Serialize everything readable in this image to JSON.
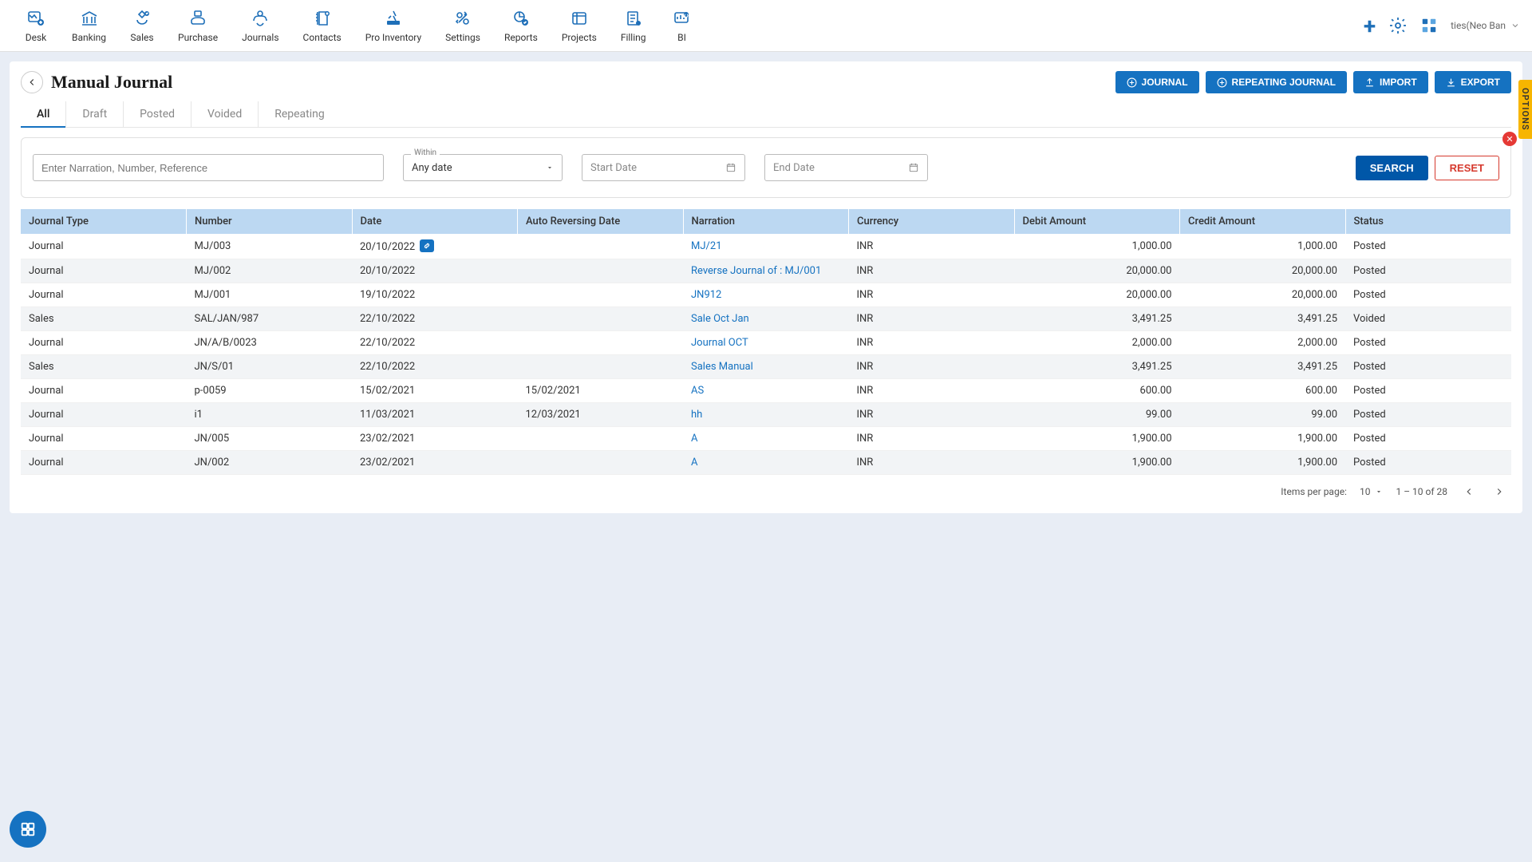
{
  "topnav": {
    "items": [
      {
        "label": "Desk"
      },
      {
        "label": "Banking"
      },
      {
        "label": "Sales"
      },
      {
        "label": "Purchase"
      },
      {
        "label": "Journals"
      },
      {
        "label": "Contacts"
      },
      {
        "label": "Pro Inventory"
      },
      {
        "label": "Settings"
      },
      {
        "label": "Reports"
      },
      {
        "label": "Projects"
      },
      {
        "label": "Filling"
      },
      {
        "label": "BI"
      }
    ],
    "user_label": "ties(Neo Ban"
  },
  "page": {
    "title": "Manual Journal"
  },
  "actions": {
    "journal": "JOURNAL",
    "repeating": "REPEATING JOURNAL",
    "import": "IMPORT",
    "export": "EXPORT"
  },
  "tabs": {
    "items": [
      "All",
      "Draft",
      "Posted",
      "Voided",
      "Repeating"
    ],
    "active": "All"
  },
  "filters": {
    "search_placeholder": "Enter Narration, Number, Reference",
    "within_label": "Within",
    "within_value": "Any date",
    "start_placeholder": "Start Date",
    "end_placeholder": "End Date",
    "search_btn": "SEARCH",
    "reset_btn": "RESET"
  },
  "table": {
    "headers": [
      "Journal Type",
      "Number",
      "Date",
      "Auto Reversing Date",
      "Narration",
      "Currency",
      "Debit Amount",
      "Credit Amount",
      "Status"
    ],
    "rows": [
      {
        "type": "Journal",
        "number": "MJ/003",
        "date": "20/10/2022",
        "date_badge": true,
        "auto": "",
        "narration": "MJ/21",
        "currency": "INR",
        "debit": "1,000.00",
        "credit": "1,000.00",
        "status": "Posted"
      },
      {
        "type": "Journal",
        "number": "MJ/002",
        "date": "20/10/2022",
        "auto": "",
        "narration": "Reverse Journal of : MJ/001",
        "currency": "INR",
        "debit": "20,000.00",
        "credit": "20,000.00",
        "status": "Posted"
      },
      {
        "type": "Journal",
        "number": "MJ/001",
        "date": "19/10/2022",
        "auto": "",
        "narration": "JN912",
        "currency": "INR",
        "debit": "20,000.00",
        "credit": "20,000.00",
        "status": "Posted"
      },
      {
        "type": "Sales",
        "number": "SAL/JAN/987",
        "date": "22/10/2022",
        "auto": "",
        "narration": "Sale Oct Jan",
        "currency": "INR",
        "debit": "3,491.25",
        "credit": "3,491.25",
        "status": "Voided"
      },
      {
        "type": "Journal",
        "number": "JN/A/B/0023",
        "date": "22/10/2022",
        "auto": "",
        "narration": "Journal OCT",
        "currency": "INR",
        "debit": "2,000.00",
        "credit": "2,000.00",
        "status": "Posted"
      },
      {
        "type": "Sales",
        "number": "JN/S/01",
        "date": "22/10/2022",
        "auto": "",
        "narration": "Sales Manual",
        "currency": "INR",
        "debit": "3,491.25",
        "credit": "3,491.25",
        "status": "Posted"
      },
      {
        "type": "Journal",
        "number": "p-0059",
        "date": "15/02/2021",
        "auto": "15/02/2021",
        "narration": "AS",
        "currency": "INR",
        "debit": "600.00",
        "credit": "600.00",
        "status": "Posted"
      },
      {
        "type": "Journal",
        "number": "i1",
        "date": "11/03/2021",
        "auto": "12/03/2021",
        "narration": "hh",
        "currency": "INR",
        "debit": "99.00",
        "credit": "99.00",
        "status": "Posted"
      },
      {
        "type": "Journal",
        "number": "JN/005",
        "date": "23/02/2021",
        "auto": "",
        "narration": "A",
        "currency": "INR",
        "debit": "1,900.00",
        "credit": "1,900.00",
        "status": "Posted"
      },
      {
        "type": "Journal",
        "number": "JN/002",
        "date": "23/02/2021",
        "auto": "",
        "narration": "A",
        "currency": "INR",
        "debit": "1,900.00",
        "credit": "1,900.00",
        "status": "Posted"
      }
    ]
  },
  "pagination": {
    "label": "Items per page:",
    "size": "10",
    "range": "1 – 10 of 28"
  },
  "options_tab": "OPTIONS"
}
